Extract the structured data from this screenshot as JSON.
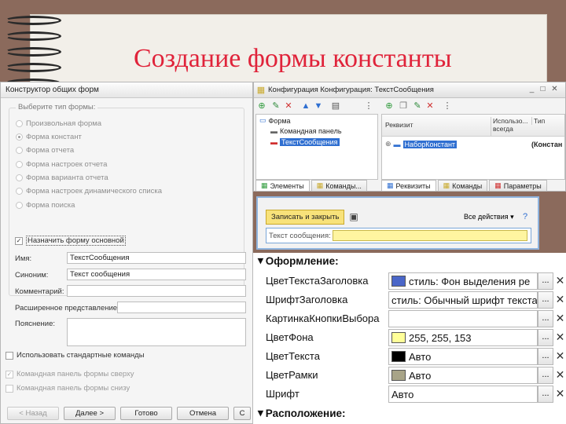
{
  "slide": {
    "title": "Создание формы константы"
  },
  "form_constructor": {
    "title": "Конструктор общих форм",
    "group_label": "Выберите тип формы:",
    "form_types": [
      "Произвольная форма",
      "Форма констант",
      "Форма отчета",
      "Форма настроек отчета",
      "Форма варианта отчета",
      "Форма настроек динамического списка",
      "Форма поиска"
    ],
    "selected_type_index": 1,
    "main_form_checkbox": "Назначить форму основной",
    "fields": {
      "name_label": "Имя:",
      "name_value": "ТекстСообщения",
      "synonym_label": "Синоним:",
      "synonym_value": "Текст сообщения",
      "comment_label": "Комментарий:",
      "extended_label": "Расширенное представление:",
      "explanation_label": "Пояснение:"
    },
    "std_commands_checkbox": "Использовать стандартные команды",
    "top_panel_checkbox": "Командная панель формы сверху",
    "bottom_panel_checkbox": "Командная панель формы снизу",
    "buttons": {
      "back": "< Назад",
      "next": "Далее >",
      "done": "Готово",
      "cancel": "Отмена",
      "partial": "С"
    }
  },
  "config_window": {
    "title": "Конфигурация Конфигурация: ТекстСообщения",
    "tree": {
      "root": "Форма",
      "child1": "Командная панель",
      "child2": "ТекстСообщения"
    },
    "grid": {
      "col_rekvizit": "Реквизит",
      "col_used": "Использо... всегда",
      "col_type": "Тип",
      "row_name": "НаборКонстант",
      "row_type": "(Констан"
    },
    "tabs_left": [
      "Элементы",
      "Команды..."
    ],
    "tabs_right": [
      "Реквизиты",
      "Команды",
      "Параметры"
    ]
  },
  "form_preview": {
    "save_button": "Записать и закрыть",
    "all_actions": "Все действия",
    "field_label": "Текст сообщения:"
  },
  "properties": {
    "section_design": "Оформление:",
    "section_layout": "Расположение:",
    "rows": [
      {
        "label": "ЦветТекстаЗаголовка",
        "value": "стиль: Фон выделения ре",
        "swatch": "#4a66c8"
      },
      {
        "label": "ШрифтЗаголовка",
        "value": "стиль: Обычный шрифт текста",
        "swatch": ""
      },
      {
        "label": "КартинкаКнопкиВыбора",
        "value": "",
        "swatch": ""
      },
      {
        "label": "ЦветФона",
        "value": "255, 255, 153",
        "swatch": "#ffff99"
      },
      {
        "label": "ЦветТекста",
        "value": "Авто",
        "swatch": "#000000"
      },
      {
        "label": "ЦветРамки",
        "value": "Авто",
        "swatch": "#a8a488"
      },
      {
        "label": "Шрифт",
        "value": "Авто",
        "swatch": ""
      }
    ]
  },
  "colors": {
    "title_red": "#e0233a",
    "selection_blue": "#2f6fd1",
    "form_yellow": "#f8e27a"
  }
}
